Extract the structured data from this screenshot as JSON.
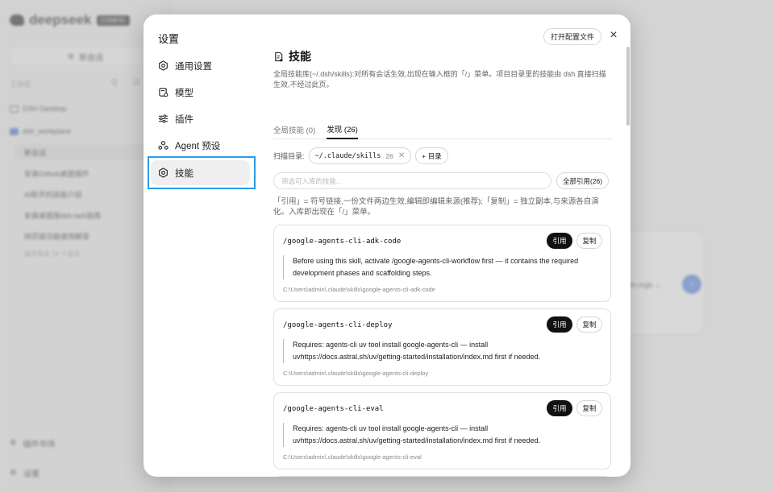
{
  "background": {
    "logo_text": "deepseek",
    "logo_tag": "CONFIG",
    "new_chat": "新会话",
    "workspace_label": "工作区",
    "workspace_icons": "Q ☷",
    "projects": [
      {
        "label": "DSH Desktop",
        "folder": "outline"
      },
      {
        "label": "dsh_workplace",
        "folder": "filled"
      }
    ],
    "sessions": [
      {
        "title": "新会话",
        "count": ""
      },
      {
        "title": "安装Github桌面插件",
        "count": "2"
      },
      {
        "title": "AI助手的技能介绍",
        "count": "2"
      },
      {
        "title": "安装桌面版dsh-lark指南",
        "count": "1"
      },
      {
        "title": "网页版功能使用解答",
        "count": "1"
      }
    ],
    "more_sessions": "展开其余 16 个会话",
    "plugin_market": "插件市场",
    "settings": "设置",
    "model_label": "sh mgh ⌄",
    "send_icon": "arrow-up-icon"
  },
  "modal": {
    "title": "设置",
    "open_config_button": "打开配置文件",
    "close_symbol": "×",
    "nav": [
      {
        "label": "通用设置",
        "icon": "settings-gear-icon",
        "active": false
      },
      {
        "label": "模型",
        "icon": "model-icon",
        "active": false
      },
      {
        "label": "插件",
        "icon": "plugin-sliders-icon",
        "active": false
      },
      {
        "label": "Agent 预设",
        "icon": "agent-icon",
        "active": false
      },
      {
        "label": "技能",
        "icon": "skill-gear-icon",
        "active": true
      }
    ],
    "page": {
      "title": "技能",
      "description": "全局技能库(~/.dsh/skills):对所有会话生效,出现在输入框的「/」菜单。项目目录里的技能由 dsh 直接扫描生效,不经过此页。",
      "tabs": [
        {
          "label": "全局技能 (0)",
          "active": false
        },
        {
          "label": "发现 (26)",
          "active": true
        }
      ],
      "scan_label": "扫描目录:",
      "scan_dir": "~/.claude/skills",
      "scan_count": "26",
      "add_dir_button": "+ 目录",
      "search_placeholder": "筛选可入库的技能...",
      "cite_all_button": "全部引用(26)",
      "note": "「引用」= 符号链接,一份文件两边生效,编辑即编辑来源(推荐);「复制」= 独立副本,与来源各自演化。入库即出现在「/」菜单。",
      "cite_label": "引用",
      "copy_label": "复制",
      "skills": [
        {
          "name": "/google-agents-cli-adk-code",
          "description": "Before using this skill, activate /google-agents-cli-workflow first — it contains the required development phases and scaffolding steps.",
          "path": "C:\\Users\\admin\\.claude\\skills\\google-agents-cli-adk-code"
        },
        {
          "name": "/google-agents-cli-deploy",
          "description": "Requires: agents-cli uv tool install google-agents-cli — install uvhttps://docs.astral.sh/uv/getting-started/installation/index.md first if needed.",
          "path": "C:\\Users\\admin\\.claude\\skills\\google-agents-cli-deploy"
        },
        {
          "name": "/google-agents-cli-eval",
          "description": "Requires: agents-cli uv tool install google-agents-cli — install uvhttps://docs.astral.sh/uv/getting-started/installation/index.md first if needed.",
          "path": "C:\\Users\\admin\\.claude\\skills\\google-agents-cli-eval"
        }
      ]
    }
  }
}
